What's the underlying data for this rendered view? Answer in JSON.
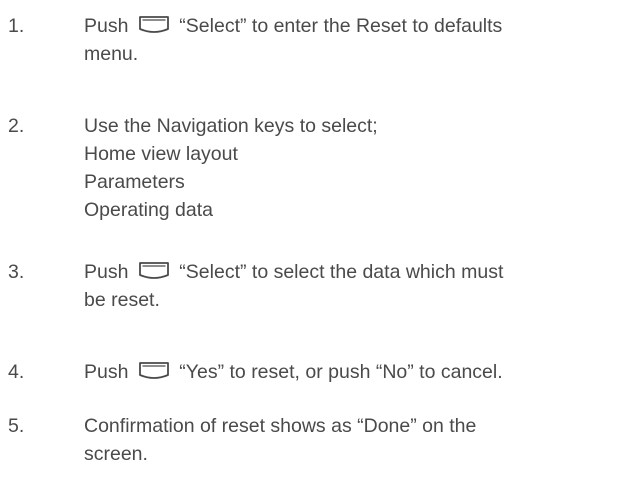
{
  "steps": [
    {
      "number": "1.",
      "prefix": "Push",
      "icon": "softkey-icon",
      "suffix": "“Select” to enter the Reset to defaults",
      "continuation": "menu."
    },
    {
      "number": "2.",
      "lines": [
        "Use the Navigation keys to select;",
        "Home view layout",
        "Parameters",
        "Operating data"
      ]
    },
    {
      "number": "3.",
      "prefix": "Push",
      "icon": "softkey-icon",
      "suffix": "“Select” to select the data which must",
      "continuation": "be reset."
    },
    {
      "number": "4.",
      "prefix": "Push",
      "icon": "softkey-icon",
      "suffix": "“Yes” to reset, or push  “No” to cancel."
    },
    {
      "number": "5.",
      "line1": "Confirmation of reset shows as “Done” on the",
      "line2": "screen."
    }
  ],
  "colors": {
    "text": "#4a4a4a",
    "icon_stroke": "#4a4a4a"
  }
}
